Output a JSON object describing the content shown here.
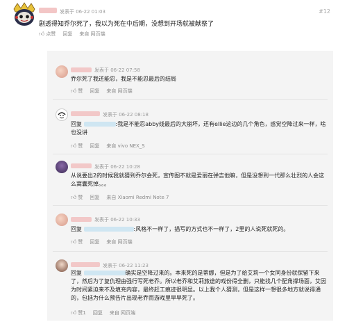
{
  "main": {
    "meta": "发表于  06-22  01:03",
    "floor": "#12",
    "text": "剧透得知乔尔死了，我以为死在中后期，没想到开场就被献祭了",
    "actions": {
      "like": "点赞",
      "reply": "回复",
      "source": "来自 网页端"
    }
  },
  "replies": [
    {
      "meta": "发表于  06-22  07:58",
      "text": "乔尔死了我还能忍，我是不能忍最后的结局",
      "actions": {
        "like": "赞",
        "reply": "回复",
        "source": "来自 网页端"
      }
    },
    {
      "meta": "发表于  06-22  08:18",
      "reply_prefix": "回复",
      "text": ":我是不能忍abby线最后的大崩坏，还有ellie这边的几个角色，感觉空降过来一样，啥也没讲",
      "actions": {
        "like": "赞",
        "reply": "回复",
        "source": "来自 vivo  NEX_S"
      }
    },
    {
      "meta": "发表于  06-22  10:28",
      "text": "从说要出2的时候我就猜到乔尔会死，宣传图不就是爱丽在弹吉他嘛，但是没想到一代那么壮烈的人会这么窝囊死掉。。。",
      "actions": {
        "like": "赞",
        "reply": "回复",
        "source": "来自 Xiaomi  Redmi  Note  7"
      }
    },
    {
      "meta": "发表于  06-22  10:33",
      "reply_prefix": "回复",
      "text": ":风格不一样了，描写的方式也不一样了，2里的人说死就死的。",
      "actions": {
        "like": "赞",
        "reply": "回复",
        "source": "来自 网页端"
      }
    },
    {
      "meta": "发表于  06-22  11:23",
      "reply_prefix": "回复",
      "text": "确实是空降过来的。本来死的是蒂娜，但是为了给艾莉一个女同身份就保留下来了，然后为了复仇理由强行写死老乔。所以老乔和艾莉旅途的戏份得全删，只能找几个配角撑场面，艾因为时间紧迫来不及填充内容，最终赶工痕迹很明显。以上我个人猜测，但是这样一想很多地方就说得通的，包括为什么预告片出现老乔而游戏里早早死了。",
      "actions": {
        "like": "赞1",
        "reply": "回复",
        "source": "来自 网页端"
      }
    }
  ],
  "colors": {
    "name_blur": "#f2c8c8",
    "at_blur": "#cfe6f2",
    "panel": "#f4f4f4"
  },
  "icons": [
    "thumbs-up-icon",
    "avatar-cartoon-icon"
  ]
}
